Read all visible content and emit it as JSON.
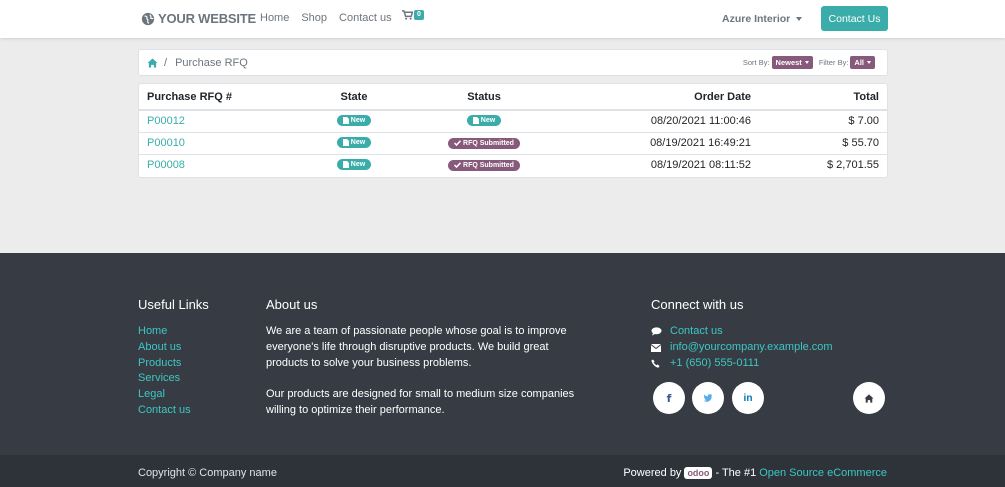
{
  "header": {
    "brand": "YOUR WEBSITE",
    "nav": [
      "Home",
      "Shop",
      "Contact us"
    ],
    "cart_count": "0",
    "user": "Azure Interior",
    "contact_button": "Contact Us"
  },
  "breadcrumb": {
    "page": "Purchase RFQ",
    "sort_label": "Sort By:",
    "sort_value": "Newest",
    "filter_label": "Filter By:",
    "filter_value": "All"
  },
  "table": {
    "headers": [
      "Purchase RFQ #",
      "State",
      "Status",
      "Order Date",
      "Total"
    ],
    "rows": [
      {
        "ref": "P00012",
        "state": "New",
        "status": "New",
        "date": "08/20/2021 11:00:46",
        "total": "$ 7.00"
      },
      {
        "ref": "P00010",
        "state": "New",
        "status": "RFQ Submitted",
        "date": "08/19/2021 16:49:21",
        "total": "$ 55.70"
      },
      {
        "ref": "P00008",
        "state": "New",
        "status": "RFQ Submitted",
        "date": "08/19/2021 08:11:52",
        "total": "$ 2,701.55"
      }
    ]
  },
  "footer": {
    "useful_links_title": "Useful Links",
    "useful_links": [
      "Home",
      "About us",
      "Products",
      "Services",
      "Legal",
      "Contact us"
    ],
    "about_title": "About us",
    "about_p1": "We are a team of passionate people whose goal is to improve everyone's life through disruptive products. We build great products to solve your business problems.",
    "about_p2": "Our products are designed for small to medium size companies willing to optimize their performance.",
    "connect_title": "Connect with us",
    "connect_contact": "Contact us",
    "connect_email": "info@yourcompany.example.com",
    "connect_phone": "+1 (650) 555-0111",
    "social": {
      "facebook": "f",
      "linkedin": "in"
    },
    "copyright": "Copyright © Company name",
    "powered_by": "Powered by",
    "odoo": "odoo",
    "the_1": "- The #1",
    "os_link": "Open Source eCommerce"
  },
  "colors": {
    "primary": "#3aadaa",
    "secondary": "#875a7b",
    "footer_bg": "#373c44"
  }
}
